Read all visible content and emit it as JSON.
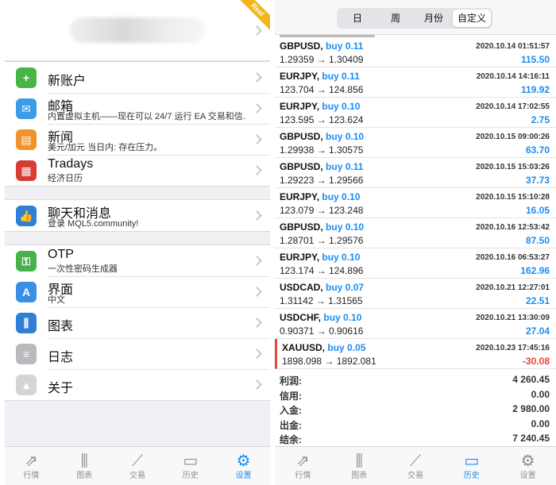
{
  "settings": {
    "account_badge": "Real",
    "groups": [
      [
        {
          "id": "new-account",
          "title": "新账户",
          "sub": "",
          "icon": "add-user-icon",
          "color": "#47b548",
          "glyph": "+"
        },
        {
          "id": "mailbox",
          "title": "邮箱",
          "sub": "内置虚拟主机——现在可以 24/7 运行 EA 交易和信...",
          "icon": "mail-icon",
          "color": "#3a9be6",
          "glyph": "✉"
        },
        {
          "id": "news",
          "title": "新闻",
          "sub": "美元/加元 当日内: 存在压力。",
          "icon": "book-icon",
          "color": "#f2932a",
          "glyph": "▤"
        },
        {
          "id": "tradays",
          "title": "Tradays",
          "sub": "经济日历",
          "icon": "calendar-icon",
          "color": "#d83b35",
          "glyph": "▦"
        }
      ],
      [
        {
          "id": "chat",
          "title": "聊天和消息",
          "sub": "登录 MQL5.community!",
          "icon": "thumbs-up-icon",
          "color": "#2f7fd6",
          "glyph": "👍"
        }
      ],
      [
        {
          "id": "otp",
          "title": "OTP",
          "sub": "一次性密码生成器",
          "icon": "key-icon",
          "color": "#49b04e",
          "glyph": "⚿"
        },
        {
          "id": "interface",
          "title": "界面",
          "sub": "中文",
          "icon": "translate-icon",
          "color": "#3a8ee3",
          "glyph": "A"
        },
        {
          "id": "charts",
          "title": "图表",
          "sub": "",
          "icon": "candles-icon",
          "color": "#2f7fd6",
          "glyph": "⫼"
        },
        {
          "id": "journal",
          "title": "日志",
          "sub": "",
          "icon": "list-icon",
          "color": "#b9b9be",
          "glyph": "≡"
        },
        {
          "id": "about",
          "title": "关于",
          "sub": "",
          "icon": "mt-logo-icon",
          "color": "#d5d5d5",
          "glyph": "▲"
        }
      ]
    ]
  },
  "left_tabs": [
    {
      "label": "行情",
      "icon": "quotes-icon",
      "glyph": "⇗",
      "active": false
    },
    {
      "label": "图表",
      "icon": "chart-icon",
      "glyph": "⫼",
      "active": false
    },
    {
      "label": "交易",
      "icon": "trade-icon",
      "glyph": "⟋",
      "active": false
    },
    {
      "label": "历史",
      "icon": "history-icon",
      "glyph": "▭",
      "active": false
    },
    {
      "label": "设置",
      "icon": "gear-icon",
      "glyph": "⚙",
      "active": true
    }
  ],
  "history": {
    "segments": [
      {
        "label": "日",
        "active": false
      },
      {
        "label": "周",
        "active": false
      },
      {
        "label": "月份",
        "active": false
      },
      {
        "label": "自定义",
        "active": true
      }
    ],
    "deals": [
      {
        "symbol": "GBPUSD,",
        "side": "buy 0.11",
        "date": "2020.10.14 01:51:57",
        "prices": "1.29359 → 1.30409",
        "profit": "115.50",
        "loss": false
      },
      {
        "symbol": "EURJPY,",
        "side": "buy 0.11",
        "date": "2020.10.14 14:16:11",
        "prices": "123.704 → 124.856",
        "profit": "119.92",
        "loss": false
      },
      {
        "symbol": "EURJPY,",
        "side": "buy 0.10",
        "date": "2020.10.14 17:02:55",
        "prices": "123.595 → 123.624",
        "profit": "2.75",
        "loss": false
      },
      {
        "symbol": "GBPUSD,",
        "side": "buy 0.10",
        "date": "2020.10.15 09:00:26",
        "prices": "1.29938 → 1.30575",
        "profit": "63.70",
        "loss": false
      },
      {
        "symbol": "GBPUSD,",
        "side": "buy 0.11",
        "date": "2020.10.15 15:03:26",
        "prices": "1.29223 → 1.29566",
        "profit": "37.73",
        "loss": false
      },
      {
        "symbol": "EURJPY,",
        "side": "buy 0.10",
        "date": "2020.10.15 15:10:28",
        "prices": "123.079 → 123.248",
        "profit": "16.05",
        "loss": false
      },
      {
        "symbol": "GBPUSD,",
        "side": "buy 0.10",
        "date": "2020.10.16 12:53:42",
        "prices": "1.28701 → 1.29576",
        "profit": "87.50",
        "loss": false
      },
      {
        "symbol": "EURJPY,",
        "side": "buy 0.10",
        "date": "2020.10.16 06:53:27",
        "prices": "123.174 → 124.896",
        "profit": "162.96",
        "loss": false
      },
      {
        "symbol": "USDCAD,",
        "side": "buy 0.07",
        "date": "2020.10.21 12:27:01",
        "prices": "1.31142 → 1.31565",
        "profit": "22.51",
        "loss": false
      },
      {
        "symbol": "USDCHF,",
        "side": "buy 0.10",
        "date": "2020.10.21 13:30:09",
        "prices": "0.90371 → 0.90616",
        "profit": "27.04",
        "loss": false
      },
      {
        "symbol": "XAUUSD,",
        "side": "buy 0.05",
        "date": "2020.10.23 17:45:16",
        "prices": "1898.098 → 1892.081",
        "profit": "-30.08",
        "loss": true
      }
    ],
    "summary": [
      {
        "label": "利润:",
        "value": "4 260.45"
      },
      {
        "label": "信用:",
        "value": "0.00"
      },
      {
        "label": "入金:",
        "value": "2 980.00"
      },
      {
        "label": "出金:",
        "value": "0.00"
      },
      {
        "label": "结余:",
        "value": "7 240.45"
      }
    ]
  },
  "right_tabs": [
    {
      "label": "行情",
      "icon": "quotes-icon",
      "glyph": "⇗",
      "active": false
    },
    {
      "label": "图表",
      "icon": "chart-icon",
      "glyph": "⫼",
      "active": false
    },
    {
      "label": "交易",
      "icon": "trade-icon",
      "glyph": "⟋",
      "active": false
    },
    {
      "label": "历史",
      "icon": "history-icon",
      "glyph": "▭",
      "active": true
    },
    {
      "label": "设置",
      "icon": "gear-icon",
      "glyph": "⚙",
      "active": false
    }
  ]
}
